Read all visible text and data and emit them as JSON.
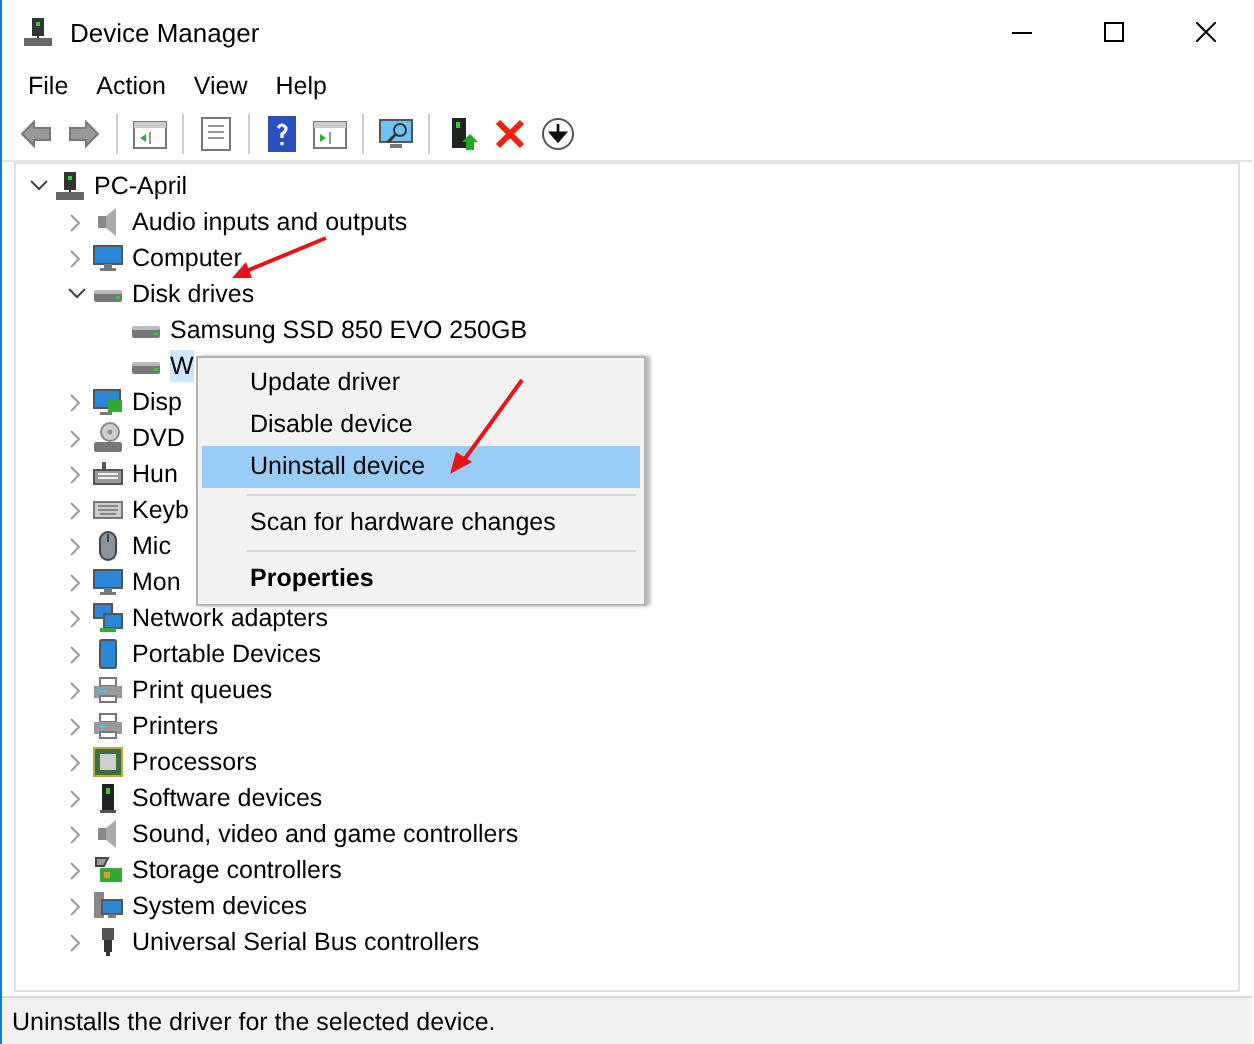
{
  "window": {
    "title": "Device Manager"
  },
  "menu_bar": [
    {
      "label": "File"
    },
    {
      "label": "Action"
    },
    {
      "label": "View"
    },
    {
      "label": "Help"
    }
  ],
  "tree": [
    {
      "label": "PC-April",
      "expanded": true,
      "selected": false,
      "children": [
        {
          "label": "Audio inputs and outputs",
          "expanded": false,
          "selected": false
        },
        {
          "label": "Computer",
          "expanded": false,
          "selected": false
        },
        {
          "label": "Disk drives",
          "expanded": true,
          "selected": false,
          "children": [
            {
              "label": "Samsung SSD 850 EVO 250GB",
              "selected": false
            },
            {
              "label": "W",
              "selected": true
            }
          ]
        },
        {
          "label": "Disp",
          "expanded": false,
          "selected": false
        },
        {
          "label": "DVD",
          "expanded": false,
          "selected": false
        },
        {
          "label": "Hun",
          "expanded": false,
          "selected": false
        },
        {
          "label": "Keyb",
          "expanded": false,
          "selected": false
        },
        {
          "label": "Mic",
          "expanded": false,
          "selected": false
        },
        {
          "label": "Mon",
          "expanded": false,
          "selected": false
        },
        {
          "label": "Network adapters",
          "expanded": false,
          "selected": false
        },
        {
          "label": "Portable Devices",
          "expanded": false,
          "selected": false
        },
        {
          "label": "Print queues",
          "expanded": false,
          "selected": false
        },
        {
          "label": "Printers",
          "expanded": false,
          "selected": false
        },
        {
          "label": "Processors",
          "expanded": false,
          "selected": false
        },
        {
          "label": "Software devices",
          "expanded": false,
          "selected": false
        },
        {
          "label": "Sound, video and game controllers",
          "expanded": false,
          "selected": false
        },
        {
          "label": "Storage controllers",
          "expanded": false,
          "selected": false
        },
        {
          "label": "System devices",
          "expanded": false,
          "selected": false
        },
        {
          "label": "Universal Serial Bus controllers",
          "expanded": false,
          "selected": false
        }
      ]
    }
  ],
  "context_menu": [
    {
      "kind": "item",
      "label": "Update driver",
      "selected": false
    },
    {
      "kind": "item",
      "label": "Disable device",
      "selected": false
    },
    {
      "kind": "item",
      "label": "Uninstall device",
      "selected": true
    },
    {
      "kind": "separator"
    },
    {
      "kind": "item",
      "label": "Scan for hardware changes",
      "selected": false
    },
    {
      "kind": "separator"
    },
    {
      "kind": "default",
      "label": "Properties",
      "selected": false
    }
  ],
  "status_bar": {
    "text": "Uninstalls the driver for the selected device."
  }
}
